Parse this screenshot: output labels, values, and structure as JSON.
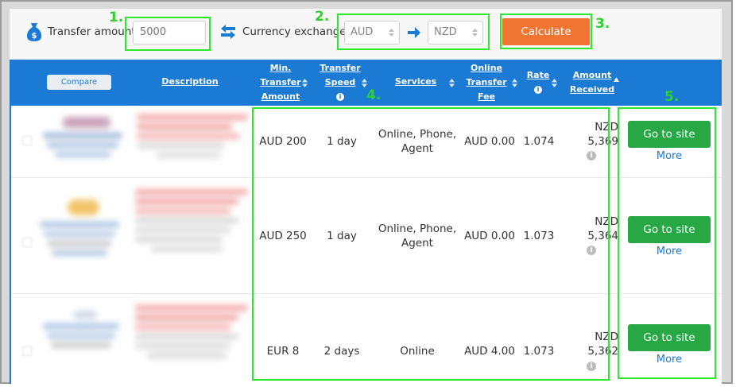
{
  "form": {
    "transfer_amount_label": "Transfer amount",
    "transfer_amount_value": "5000",
    "currency_exchange_label": "Currency exchange",
    "from_currency": "AUD",
    "to_currency": "NZD",
    "calculate_label": "Calculate"
  },
  "annotations": [
    "1.",
    "2.",
    "3.",
    "4.",
    "5."
  ],
  "table": {
    "compare_label": "Compare",
    "headers": {
      "description": "Description",
      "min_transfer": [
        "Min.",
        "Transfer",
        "Amount"
      ],
      "transfer_speed": [
        "Transfer",
        "Speed"
      ],
      "services": "Services",
      "online_fee": [
        "Online",
        "Transfer",
        "Fee"
      ],
      "rate": "Rate",
      "amount_received": [
        "Amount",
        "Received"
      ]
    },
    "rows": [
      {
        "min": "AUD 200",
        "speed": "1 day",
        "services": [
          "Online, Phone,",
          "Agent"
        ],
        "fee": "AUD 0.00",
        "rate": "1.074",
        "received": [
          "NZD",
          "5,369"
        ],
        "go": "Go to site",
        "more": "More"
      },
      {
        "min": "AUD 250",
        "speed": "1 day",
        "services": [
          "Online, Phone,",
          "Agent"
        ],
        "fee": "AUD 0.00",
        "rate": "1.073",
        "received": [
          "NZD",
          "5,364"
        ],
        "go": "Go to site",
        "more": "More"
      },
      {
        "min": "EUR 8",
        "speed": "2 days",
        "services": [
          "Online"
        ],
        "fee": "AUD 4.00",
        "rate": "1.073",
        "received": [
          "NZD",
          "5,362"
        ],
        "go": "Go to site",
        "more": "More"
      }
    ]
  },
  "colors": {
    "header_blue": "#1b7ad3",
    "calculate_orange": "#f07432",
    "go_green": "#27a845",
    "annotation_green": "#2ee82e"
  }
}
